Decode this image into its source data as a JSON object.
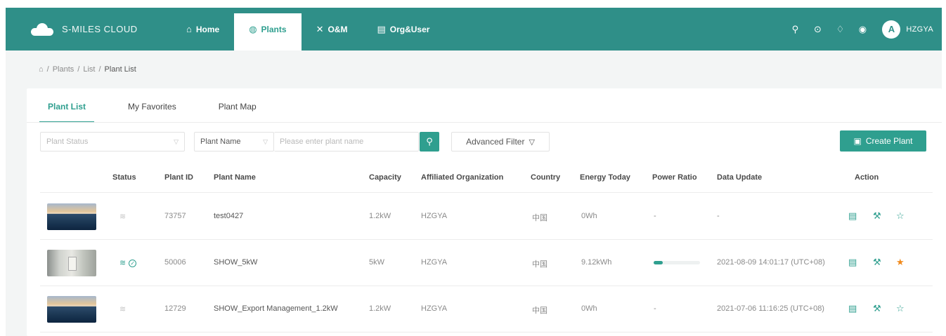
{
  "brand": {
    "name": "S-MILES CLOUD"
  },
  "nav": {
    "items": [
      {
        "label": "Home",
        "icon": "home-icon"
      },
      {
        "label": "Plants",
        "icon": "globe-icon"
      },
      {
        "label": "O&M",
        "icon": "tools-icon"
      },
      {
        "label": "Org&User",
        "icon": "org-icon"
      }
    ],
    "active": "Plants",
    "user": {
      "initial": "A",
      "name": "HZGYA"
    }
  },
  "breadcrumb": [
    "Plants",
    "List",
    "Plant List"
  ],
  "tabs": [
    "Plant List",
    "My Favorites",
    "Plant Map"
  ],
  "active_tab": "Plant List",
  "filters": {
    "plant_status_placeholder": "Plant Status",
    "name_select": "Plant Name",
    "name_placeholder": "Please enter plant name",
    "advanced_label": "Advanced Filter",
    "create_label": "Create Plant"
  },
  "table": {
    "columns": [
      "Status",
      "Plant ID",
      "Plant Name",
      "Capacity",
      "Affiliated Organization",
      "Country",
      "Energy Today",
      "Power Ratio",
      "Data Update",
      "Action"
    ],
    "rows": [
      {
        "thumb": "solar",
        "online": false,
        "id": "73757",
        "name": "test0427",
        "capacity": "1.2kW",
        "org": "HZGYA",
        "country": "中国",
        "energy": "0Wh",
        "ratio_text": "-",
        "ratio": null,
        "update": "-",
        "favorite": false
      },
      {
        "thumb": "indoor",
        "online": true,
        "id": "50006",
        "name": "SHOW_5kW",
        "capacity": "5kW",
        "org": "HZGYA",
        "country": "中国",
        "energy": "9.12kWh",
        "ratio_text": "",
        "ratio": 0.2,
        "update": "2021-08-09 14:01:17 (UTC+08)",
        "favorite": true
      },
      {
        "thumb": "solar",
        "online": false,
        "id": "12729",
        "name": "SHOW_Export Management_1.2kW",
        "capacity": "1.2kW",
        "org": "HZGYA",
        "country": "中国",
        "energy": "0Wh",
        "ratio_text": "-",
        "ratio": null,
        "update": "2021-07-06 11:16:25 (UTC+08)",
        "favorite": false
      }
    ]
  },
  "colors": {
    "nav_bg": "#2f8f88",
    "accent": "#2f9f8f",
    "star_active": "#f08a1c"
  }
}
